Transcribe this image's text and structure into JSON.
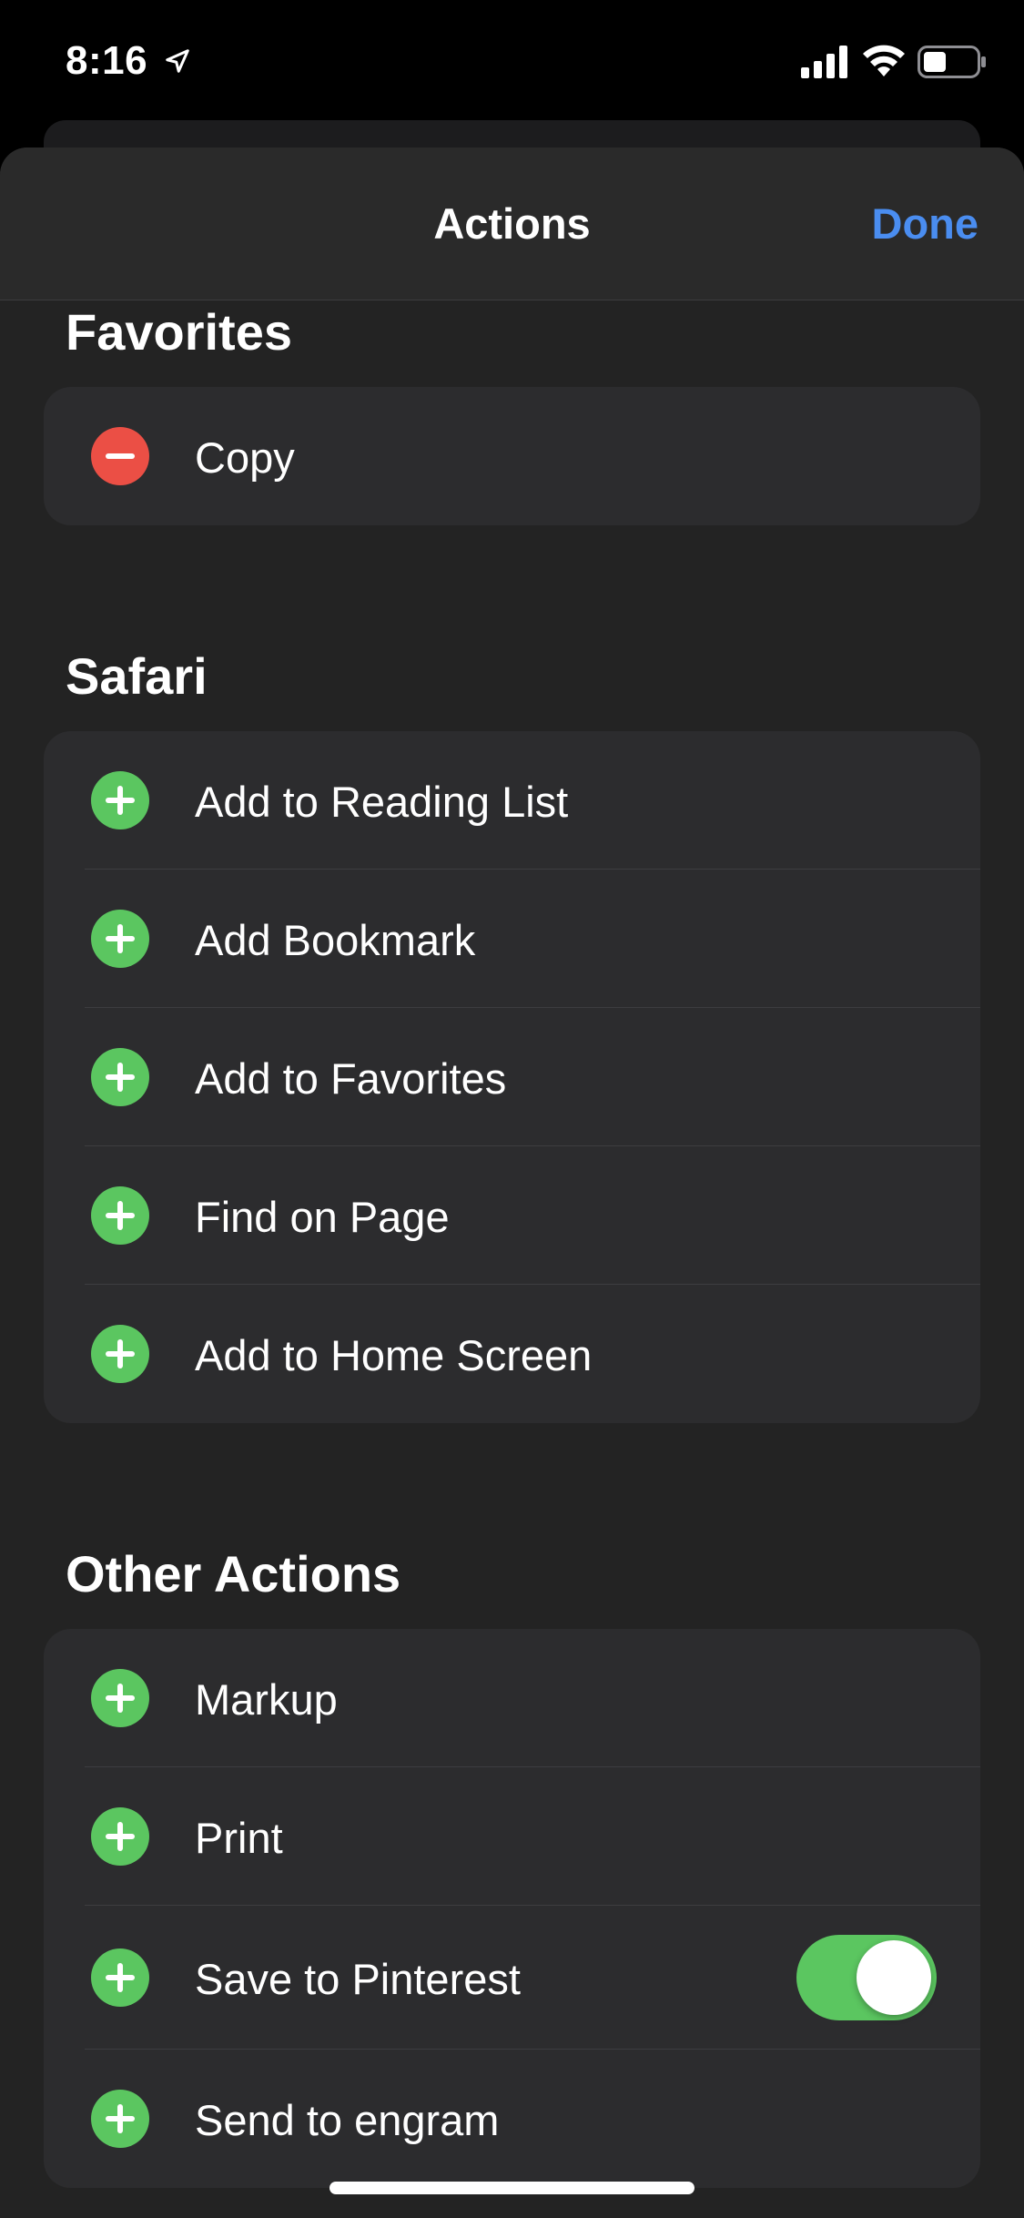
{
  "status_bar": {
    "time": "8:16"
  },
  "sheet": {
    "title": "Actions",
    "done_label": "Done"
  },
  "sections": {
    "favorites": {
      "title": "Favorites",
      "items": [
        {
          "label": "Copy",
          "action": "remove"
        }
      ]
    },
    "safari": {
      "title": "Safari",
      "items": [
        {
          "label": "Add to Reading List",
          "action": "add"
        },
        {
          "label": "Add Bookmark",
          "action": "add"
        },
        {
          "label": "Add to Favorites",
          "action": "add"
        },
        {
          "label": "Find on Page",
          "action": "add"
        },
        {
          "label": "Add to Home Screen",
          "action": "add"
        }
      ]
    },
    "other": {
      "title": "Other Actions",
      "items": [
        {
          "label": "Markup",
          "action": "add"
        },
        {
          "label": "Print",
          "action": "add"
        },
        {
          "label": "Save to Pinterest",
          "action": "add",
          "toggle": true
        },
        {
          "label": "Send to engram",
          "action": "add"
        }
      ]
    }
  },
  "colors": {
    "accent": "#4a8df0",
    "add": "#5bc660",
    "remove": "#eb4f45",
    "toggle_on": "#5bc660"
  }
}
